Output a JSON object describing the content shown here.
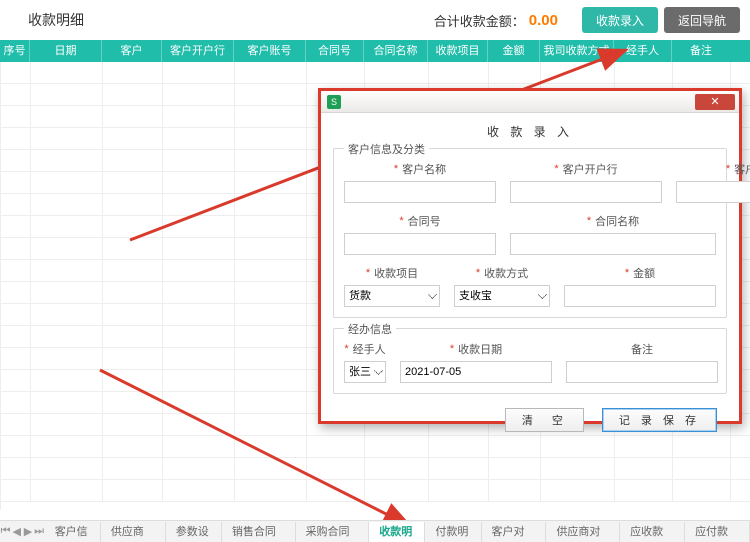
{
  "topbar": {
    "title": "收款明细",
    "total_label": "合计收款金额：",
    "total_value": "0.00",
    "entry_btn": "收款录入",
    "back_btn": "返回导航"
  },
  "columns": [
    {
      "label": "序号",
      "w": 30
    },
    {
      "label": "日期",
      "w": 72
    },
    {
      "label": "客户",
      "w": 60
    },
    {
      "label": "客户开户行",
      "w": 72
    },
    {
      "label": "客户账号",
      "w": 72
    },
    {
      "label": "合同号",
      "w": 58
    },
    {
      "label": "合同名称",
      "w": 64
    },
    {
      "label": "收款项目",
      "w": 60
    },
    {
      "label": "金额",
      "w": 52
    },
    {
      "label": "我司收款方式",
      "w": 74
    },
    {
      "label": "经手人",
      "w": 58
    },
    {
      "label": "备注",
      "w": 58
    }
  ],
  "tabs": {
    "items": [
      "客户信息",
      "供应商信息",
      "参数设置",
      "销售合同明细",
      "采购合同明细",
      "收款明细",
      "付款明细",
      "客户对账单",
      "供应商对账单",
      "应收款汇总",
      "应付款汇总"
    ],
    "active_index": 5
  },
  "dialog": {
    "heading": "收 款 录 入",
    "group1_title": "客户信息及分类",
    "group2_title": "经办信息",
    "labels": {
      "cust_name": "客户名称",
      "cust_bank": "客户开户行",
      "cust_acct": "客户账号",
      "contract_no": "合同号",
      "contract_name": "合同名称",
      "pay_item": "收款项目",
      "pay_method": "收款方式",
      "amount": "金额",
      "handler": "经手人",
      "date": "收款日期",
      "remark": "备注"
    },
    "values": {
      "pay_item": "货款",
      "pay_method": "支收宝",
      "handler": "张三",
      "date": "2021-07-05"
    },
    "clear_btn": "清　空",
    "save_btn": "记 录 保 存"
  }
}
